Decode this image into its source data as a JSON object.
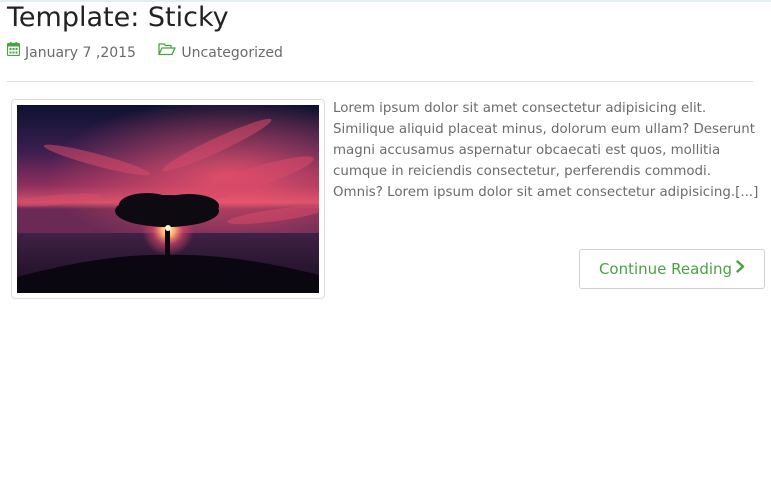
{
  "post": {
    "title": "Template: Sticky",
    "date": "January 7 ,2015",
    "category": "Uncategorized",
    "excerpt": "Lorem ipsum dolor sit amet consectetur adipisicing elit. Similique aliquid placeat minus, dolorum eum ullam? Deserunt magni accusamus aspernatur obcaecati est quos, mollitia cumque in reiciendis consectetur, perferendis commodi. Omnis? Lorem ipsum dolor sit amet consectetur adipisicing.[...]",
    "read_more_label": "Continue Reading"
  },
  "icons": {
    "date": "calendar-icon",
    "category": "folder-open-icon",
    "read_more": "chevron-right-icon"
  },
  "colors": {
    "accent": "#4aa341",
    "title": "#222222",
    "text": "#6b6b6b",
    "border": "#dcdcdc"
  }
}
